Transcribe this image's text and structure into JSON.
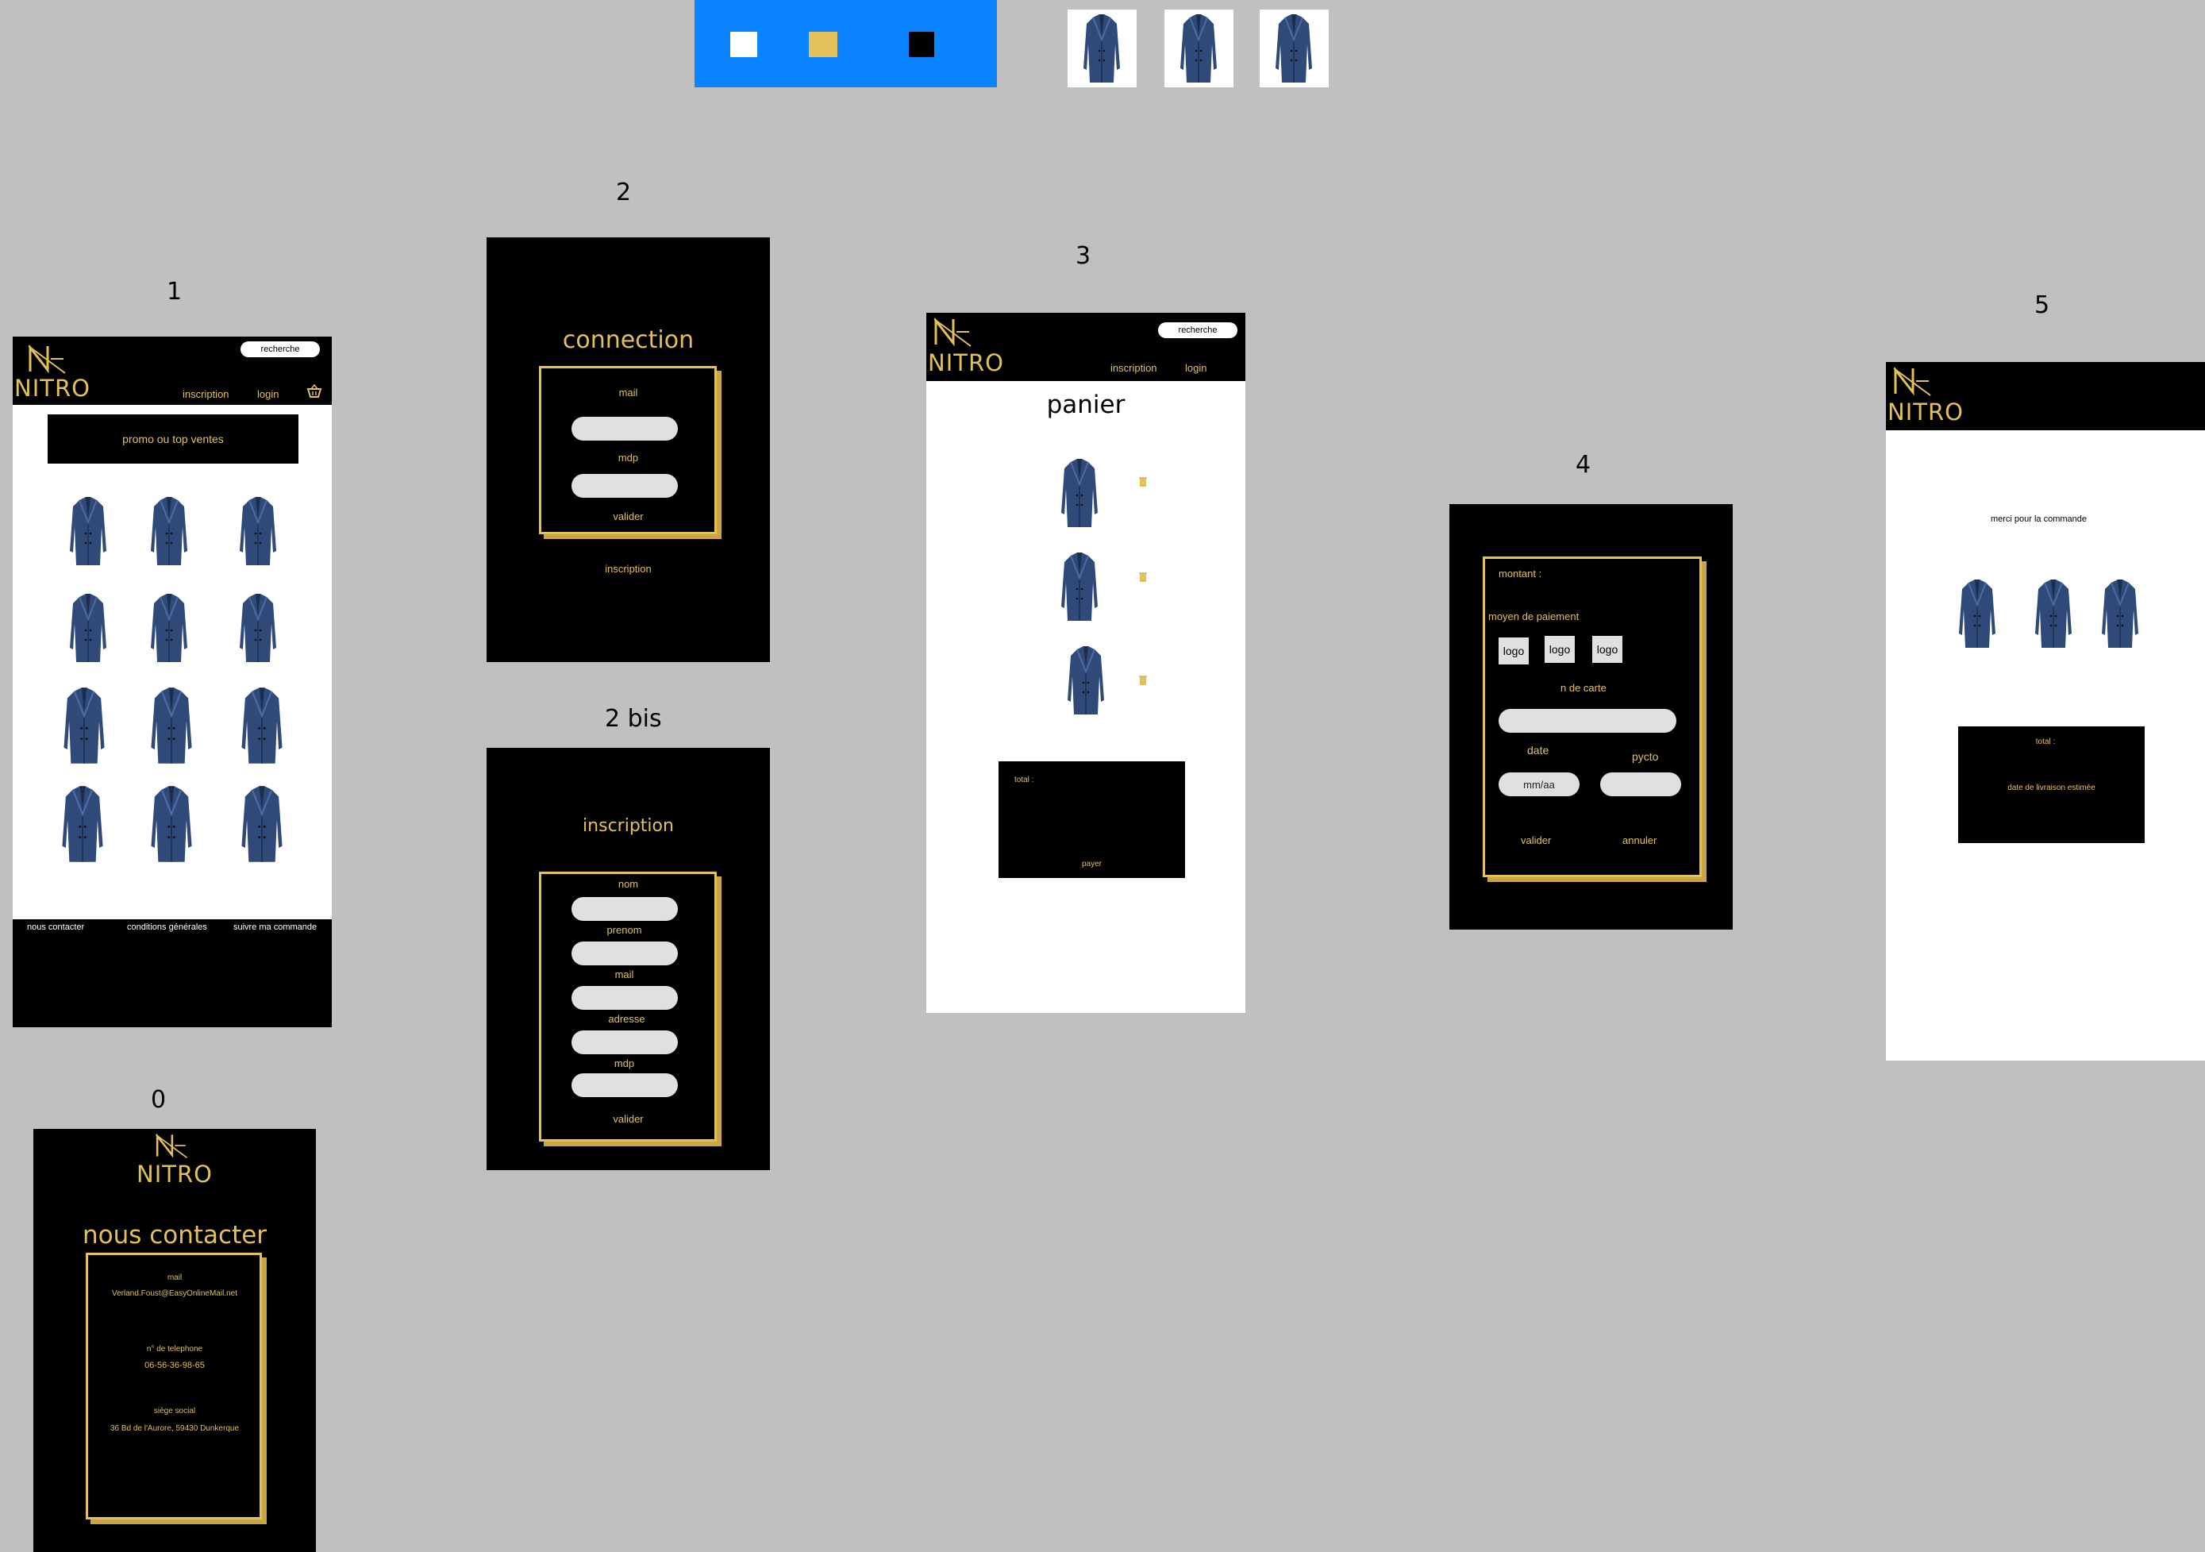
{
  "palette": {
    "swatches": [
      "#ffffff",
      "#e2c05a",
      "#000000"
    ],
    "panel_color": "#0a84ff"
  },
  "frames": {
    "f0": "0",
    "f1": "1",
    "f2": "2",
    "f2bis": "2 bis",
    "f3": "3",
    "f4": "4",
    "f5": "5"
  },
  "brand": "NITRO",
  "header": {
    "search_label": "recherche",
    "inscription": "inscription",
    "login": "login"
  },
  "screen1": {
    "promo": "promo ou top ventes",
    "footer": [
      "nous contacter",
      "conditions générales",
      "suivre ma commande"
    ]
  },
  "screen2": {
    "title": "connection",
    "mail": "mail",
    "mdp": "mdp",
    "valider": "valider",
    "inscription": "inscription"
  },
  "screen2bis": {
    "title": "inscription",
    "fields": [
      "nom",
      "prenom",
      "mail",
      "adresse",
      "mdp"
    ],
    "valider": "valider"
  },
  "screen3": {
    "title": "panier",
    "total": "total :",
    "payer": "payer"
  },
  "screen4": {
    "montant": "montant :",
    "moyen": "moyen de paiement",
    "logos": [
      "logo",
      "logo",
      "logo"
    ],
    "card": "n de carte",
    "date": "date",
    "pycto": "pycto",
    "date_placeholder": "mm/aa",
    "valider": "valider",
    "annuler": "annuler"
  },
  "screen5": {
    "merci": "merci pour la commande",
    "total": "total :",
    "livraison": "date de livraison estimée"
  },
  "screen0": {
    "title": "nous contacter",
    "mail_label": "mail",
    "mail": "Verland.Foust@EasyOnlineMail.net",
    "tel_label": "n° de telephone",
    "tel": "06-56-36-98-65",
    "siege_label": "siège social",
    "siege": "36 Bd de l'Aurore, 59430 Dunkerque"
  }
}
